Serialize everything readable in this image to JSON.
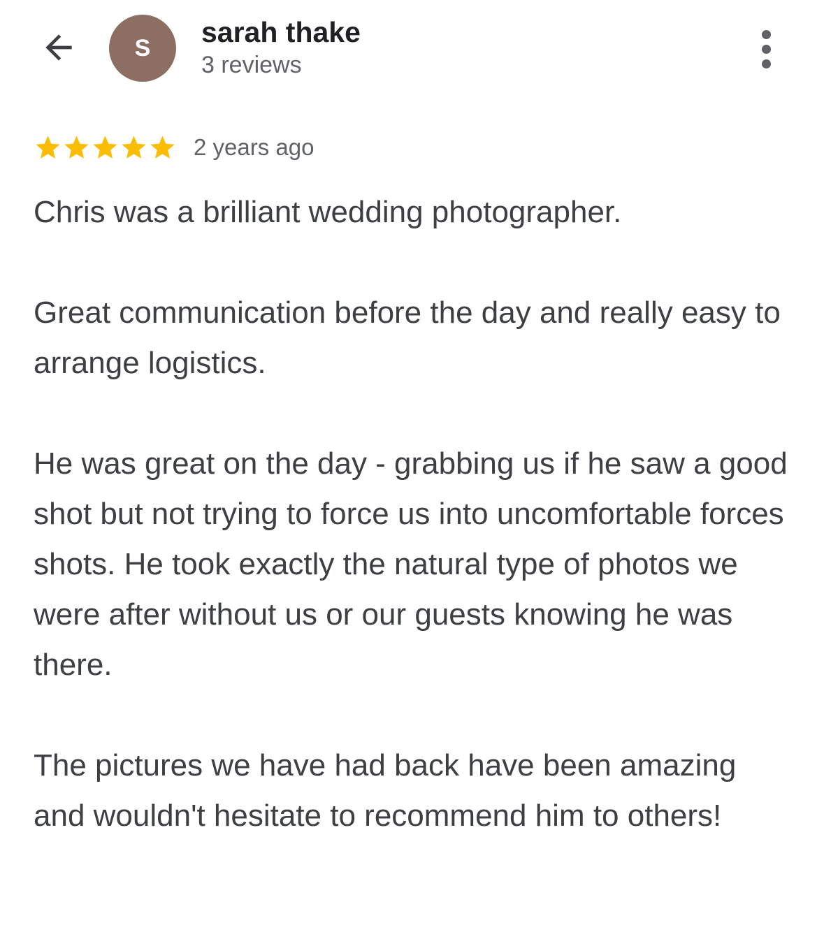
{
  "header": {
    "back_icon": "arrow-left-icon",
    "avatar_initial": "S",
    "avatar_color": "#8d6e63",
    "user_name": "sarah thake",
    "review_count": "3 reviews",
    "more_icon": "more-vertical-icon"
  },
  "review": {
    "rating": 5,
    "max_rating": 5,
    "star_color": "#fbbc04",
    "date": "2 years ago",
    "paragraphs": [
      "Chris was a brilliant wedding photographer.",
      "Great communication before the day and really easy to arrange logistics.",
      "He was great on the day - grabbing us if he saw a good shot but not trying to force us into uncomfortable forces shots. He took exactly the natural type of photos we were after without us or our guests knowing he was there.",
      "The pictures we have had back have been amazing and wouldn't hesitate to recommend him to others!"
    ]
  }
}
